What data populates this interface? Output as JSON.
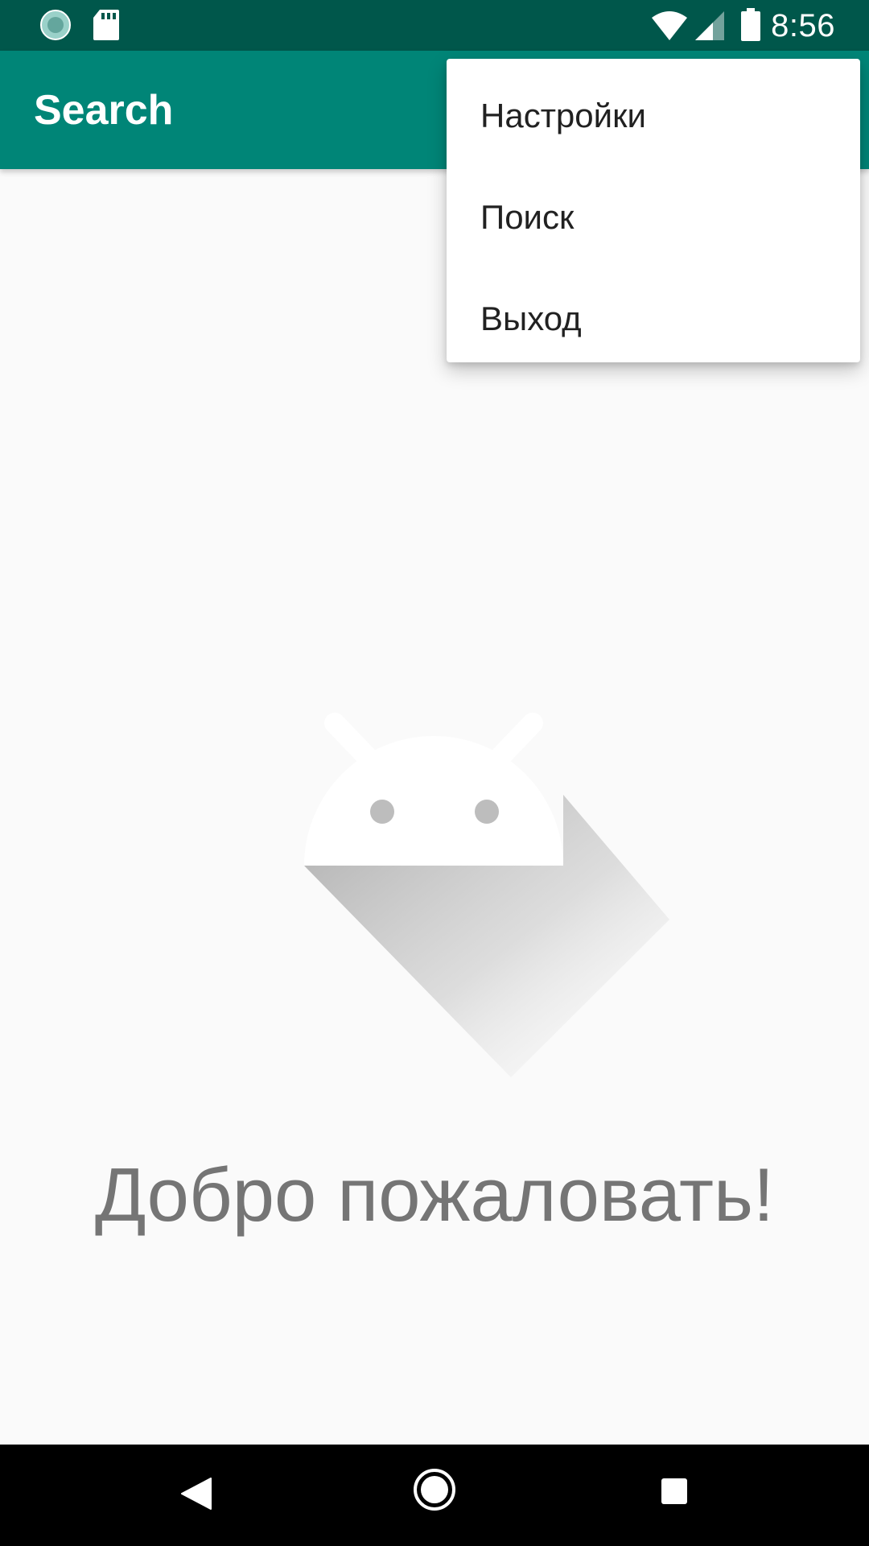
{
  "status_bar": {
    "time": "8:56",
    "icons": [
      "sync-icon",
      "sd-card-icon",
      "wifi-icon",
      "cell-signal-icon",
      "battery-icon"
    ]
  },
  "app_bar": {
    "title": "Search",
    "color": "#008577",
    "status_color": "#00574b"
  },
  "menu": {
    "items": [
      {
        "label": "Настройки"
      },
      {
        "label": "Поиск"
      },
      {
        "label": "Выход"
      }
    ]
  },
  "main": {
    "welcome_text": "Добро пожаловать!",
    "illustration": "android-logo-icon"
  },
  "nav_bar": {
    "buttons": [
      "back-icon",
      "home-icon",
      "recents-icon"
    ]
  }
}
